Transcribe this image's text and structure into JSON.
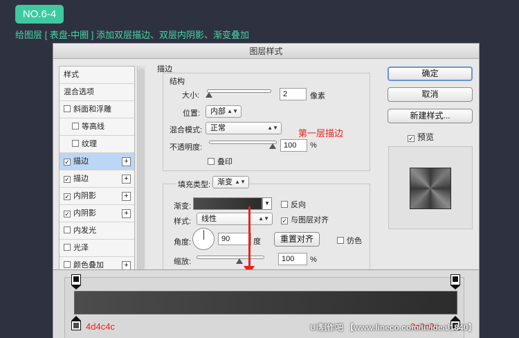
{
  "header": {
    "badge": "NO.6-4",
    "subtitle": "给图层 [ 表盘-中圈 ] 添加双层描边、双层内阴影、渐变叠加"
  },
  "dialog": {
    "title": "图层样式",
    "styles_list": [
      {
        "label": "样式",
        "checkbox": false,
        "checked": false,
        "plus": false,
        "indent": false,
        "selected": false
      },
      {
        "label": "混合选项",
        "checkbox": false,
        "checked": false,
        "plus": false,
        "indent": false,
        "selected": false
      },
      {
        "label": "斜面和浮雕",
        "checkbox": true,
        "checked": false,
        "plus": false,
        "indent": false,
        "selected": false
      },
      {
        "label": "等高线",
        "checkbox": true,
        "checked": false,
        "plus": false,
        "indent": true,
        "selected": false
      },
      {
        "label": "纹理",
        "checkbox": true,
        "checked": false,
        "plus": false,
        "indent": true,
        "selected": false
      },
      {
        "label": "描边",
        "checkbox": true,
        "checked": true,
        "plus": true,
        "indent": false,
        "selected": true
      },
      {
        "label": "描边",
        "checkbox": true,
        "checked": true,
        "plus": true,
        "indent": false,
        "selected": false
      },
      {
        "label": "内阴影",
        "checkbox": true,
        "checked": true,
        "plus": true,
        "indent": false,
        "selected": false
      },
      {
        "label": "内阴影",
        "checkbox": true,
        "checked": true,
        "plus": true,
        "indent": false,
        "selected": false
      },
      {
        "label": "内发光",
        "checkbox": true,
        "checked": false,
        "plus": false,
        "indent": false,
        "selected": false
      },
      {
        "label": "光泽",
        "checkbox": true,
        "checked": false,
        "plus": false,
        "indent": false,
        "selected": false
      },
      {
        "label": "颜色叠加",
        "checkbox": true,
        "checked": false,
        "plus": true,
        "indent": false,
        "selected": false
      }
    ],
    "stroke": {
      "section_title": "描边",
      "structure_title": "结构",
      "size_label": "大小:",
      "size_value": "2",
      "size_unit": "像素",
      "position_label": "位置:",
      "position_value": "内部",
      "blend_label": "混合模式:",
      "blend_value": "正常",
      "opacity_label": "不透明度:",
      "opacity_value": "100",
      "opacity_unit": "%",
      "overprint_label": "叠印",
      "fill_type_label": "填充类型:",
      "fill_type_value": "渐变",
      "gradient_label": "渐变:",
      "reverse_label": "反向",
      "style_label": "样式:",
      "style_value": "线性",
      "align_label": "与图层对齐",
      "angle_label": "角度:",
      "angle_value": "90",
      "angle_unit": "度",
      "reset_align_label": "重置对齐",
      "dither_label": "仿色",
      "scale_label": "缩放:",
      "scale_value": "100",
      "scale_unit": "%"
    },
    "buttons": {
      "ok": "确定",
      "cancel": "取消",
      "new_style": "新建样式...",
      "preview_label": "预览"
    }
  },
  "annotations": {
    "first_stroke": "第一层描边",
    "left_color": "4d4c4c",
    "right_color": "2c2c2c"
  },
  "watermark": "UI制作吧 【www.lineco.com/ui/idea/1840】",
  "colors": {
    "gradient_start": "#4d4c4c",
    "gradient_end": "#2c2c2c",
    "accent": "#3ec9a0",
    "annotation": "#e8231b"
  }
}
